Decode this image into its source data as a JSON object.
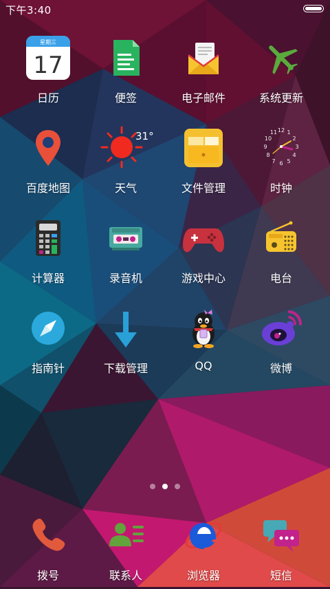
{
  "status_bar": {
    "time": "下午3:40"
  },
  "home": {
    "apps": [
      {
        "label": "日历",
        "icon": "calendar-icon",
        "day": "17",
        "weekday": "星期三"
      },
      {
        "label": "便签",
        "icon": "notes-icon"
      },
      {
        "label": "电子邮件",
        "icon": "email-icon"
      },
      {
        "label": "系统更新",
        "icon": "airplane-icon"
      },
      {
        "label": "百度地图",
        "icon": "map-pin-icon"
      },
      {
        "label": "天气",
        "icon": "sun-icon",
        "temperature": "31°"
      },
      {
        "label": "文件管理",
        "icon": "folder-icon"
      },
      {
        "label": "时钟",
        "icon": "clock-icon"
      },
      {
        "label": "计算器",
        "icon": "calculator-icon"
      },
      {
        "label": "录音机",
        "icon": "tape-recorder-icon"
      },
      {
        "label": "游戏中心",
        "icon": "gamepad-icon"
      },
      {
        "label": "电台",
        "icon": "radio-icon"
      },
      {
        "label": "指南针",
        "icon": "compass-icon"
      },
      {
        "label": "下载管理",
        "icon": "download-arrow-icon"
      },
      {
        "label": "QQ",
        "icon": "qq-penguin-icon"
      },
      {
        "label": "微博",
        "icon": "weibo-icon"
      }
    ],
    "page_indicator": {
      "total_pages": 3,
      "active_page": 2
    }
  },
  "dock": {
    "apps": [
      {
        "label": "拨号",
        "icon": "phone-icon"
      },
      {
        "label": "联系人",
        "icon": "contacts-icon"
      },
      {
        "label": "浏览器",
        "icon": "browser-icon"
      },
      {
        "label": "短信",
        "icon": "message-icon"
      }
    ]
  },
  "colors": {
    "calendar_header": "#3aa0e8",
    "notes_green": "#29b35f",
    "email_yellow": "#f6c42f",
    "update_green": "#5aaa3c",
    "map_red": "#e8503a",
    "sun_red": "#f02a1e",
    "folder_yellow": "#f5c030",
    "compass_blue": "#2ba9dc",
    "download_blue": "#2aa0d8",
    "weibo_purple": "#6a3fd6",
    "dialer_red": "#e25a3c",
    "contacts_green": "#62a33b",
    "browser_blue": "#1b5ad8",
    "message_teal": "#47a9b5"
  }
}
